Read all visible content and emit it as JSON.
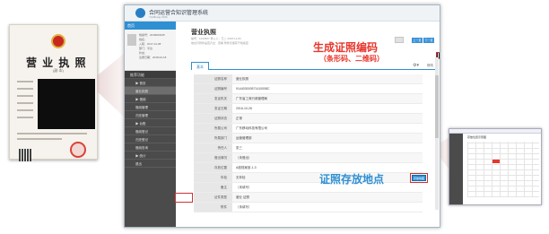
{
  "license_photo": {
    "title": "营 业 执 照",
    "subtitle": "(副 本)"
  },
  "app": {
    "title": "合同运营合知识管理系统",
    "subtitle": "YiziZhang KMS"
  },
  "sidebar": {
    "header": "首页",
    "user_lines": [
      "档案号：2018000345",
      "姓名：",
      "入职：2017-12-08",
      "部门：平台",
      "状态：",
      "注册日期：2018-02-18"
    ],
    "menu_title": "推荐功能",
    "items": [
      {
        "label": "▶ 首页"
      },
      {
        "label": "营业执照"
      },
      {
        "label": "▶ 借阅"
      },
      {
        "label": "借阅管理"
      },
      {
        "label": "归还管理"
      },
      {
        "label": "▶ 台账"
      },
      {
        "label": "借阅登记"
      },
      {
        "label": "归还登记"
      },
      {
        "label": "借阅查询"
      },
      {
        "label": "▶ 统计"
      },
      {
        "label": "退出"
      }
    ]
  },
  "content": {
    "page_title": "营业执照",
    "meta": "编号：1234567  录入人：王二  2018-12-06",
    "meta2": "地址与附件是否齐全：查看 附件仅保存于档案室",
    "nav_prev": "上一页",
    "nav_next": "下一页",
    "tab": "基本",
    "edit_label": "修改",
    "rows": [
      {
        "label": "证照名称",
        "value": "营业执照"
      },
      {
        "label": "证照编号",
        "value": "914403000571410008C"
      },
      {
        "label": "发证机关",
        "value": "广东省工商行政管理局"
      },
      {
        "label": "发证日期",
        "value": "2016-10-26"
      },
      {
        "label": "证照状态",
        "value": "正常"
      },
      {
        "label": "所属公司",
        "value": "广东移动科技有限公司"
      },
      {
        "label": "所属部门",
        "value": "运营管理部"
      },
      {
        "label": "责任人",
        "value": "张三"
      },
      {
        "label": "借出情况",
        "value": "（未借出）"
      },
      {
        "label": "存放位置",
        "value": "A座档案室-1-3"
      },
      {
        "label": "年检",
        "value": "无年检"
      },
      {
        "label": "备注",
        "value": "（未填写）"
      },
      {
        "label": "证件类型",
        "value": "营业 证照"
      },
      {
        "label": "附件",
        "value": "（未填写）"
      }
    ],
    "location_button": "存放地图"
  },
  "annotations": {
    "barcode_title": "生成证照编码",
    "barcode_sub": "（条形码、二维码）",
    "location_title": "证照存放地点"
  },
  "thumbnail": {
    "title": "存放位置示意图"
  },
  "colors": {
    "accent": "#2f8fd3",
    "annotation_red": "#e8362b",
    "sidebar_bg": "#4b4b4b"
  }
}
